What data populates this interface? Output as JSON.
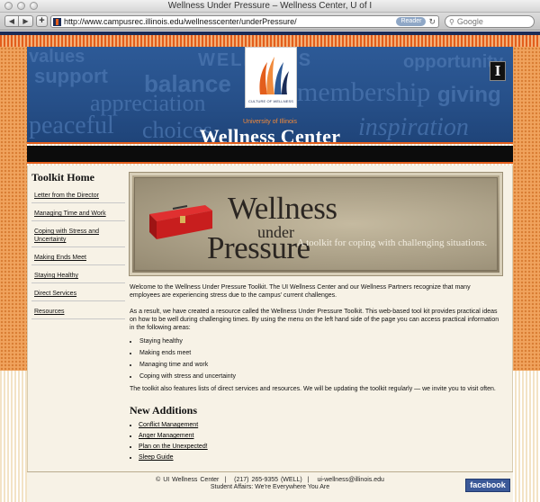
{
  "browser": {
    "window_title": "Wellness Under Pressure – Wellness Center, U of I",
    "url": "http://www.campusrec.illinois.edu/wellnesscenter/underPressure/",
    "reader_label": "Reader",
    "search_placeholder": "Google"
  },
  "header": {
    "logo_caption": "CULTURE OF WELLNESS",
    "university": "University of Illinois",
    "title": "Wellness Center",
    "i_mark": "I",
    "background_words": [
      "values",
      "support",
      "balance",
      "WELLNESS",
      "opportunity",
      "appreciation",
      "membership",
      "giving",
      "peaceful",
      "choices",
      "inspiration"
    ]
  },
  "sidebar": {
    "heading": "Toolkit Home",
    "items": [
      "Letter from the Director",
      "Managing Time and Work",
      "Coping with Stress and Uncertainty",
      "Making Ends Meet",
      "Staying Healthy",
      "Direct Services",
      "Resources"
    ]
  },
  "hero": {
    "line1": "Wellness",
    "line2": "under",
    "line3": "Pressure",
    "tagline": "A toolkit for coping with challenging situations."
  },
  "main": {
    "intro": "Welcome to the Wellness Under Pressure Toolkit. The UI Wellness Center and our Wellness Partners recognize that many employees are experiencing stress due to the campus' current challenges.",
    "para2": "As a result, we have created a resource called the Wellness Under Pressure Toolkit. This web-based tool kit provides practical ideas on how to be well during challenging times. By using the menu on the left hand side of the page you can access practical information in the following areas:",
    "areas": [
      "Staying healthy",
      "Making ends meet",
      "Managing time and work",
      "Coping with stress and uncertainty"
    ],
    "para3": "The toolkit also features lists of direct services and resources. We will be updating the toolkit regularly — we invite you to visit often.",
    "new_additions_heading": "New Additions",
    "new_additions": [
      "Conflict Management",
      "Anger Management",
      "Plan on the Unexpected!",
      "Sleep Guide"
    ]
  },
  "footer": {
    "copyright": "© UI Wellness Center",
    "phone": "(217) 265-9355 (WELL)",
    "email": "ui-wellness@illinois.edu",
    "tagline": "Student Affairs: We're Everywhere You Are",
    "facebook": "facebook"
  },
  "colors": {
    "illinois_blue": "#1b2c57",
    "illinois_orange": "#e35e1c",
    "header_blue": "#2d5a97",
    "content_bg": "#f7f2e6",
    "facebook_blue": "#3b5998"
  }
}
